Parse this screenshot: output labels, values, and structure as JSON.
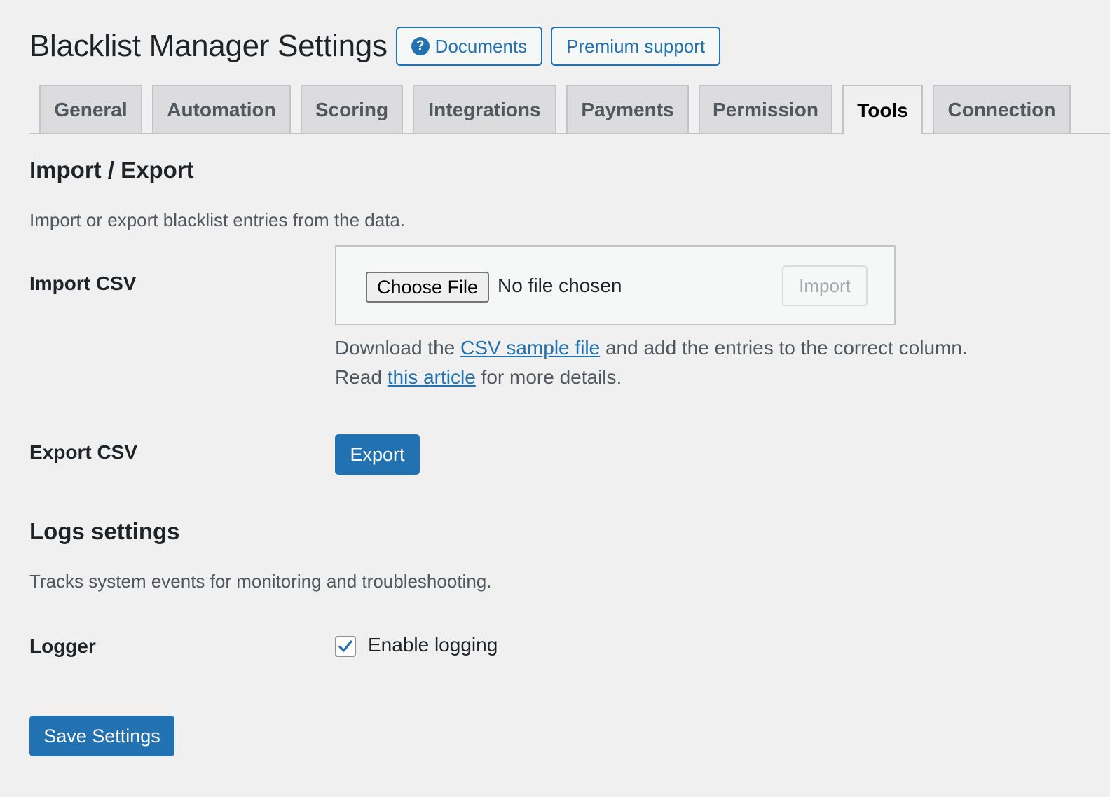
{
  "header": {
    "title": "Blacklist Manager Settings",
    "documents_label": "Documents",
    "premium_label": "Premium support",
    "help_icon": "?"
  },
  "tabs": [
    {
      "label": "General"
    },
    {
      "label": "Automation"
    },
    {
      "label": "Scoring"
    },
    {
      "label": "Integrations"
    },
    {
      "label": "Payments"
    },
    {
      "label": "Permission"
    },
    {
      "label": "Tools",
      "active": true
    },
    {
      "label": "Connection"
    }
  ],
  "import_export": {
    "heading": "Import / Export",
    "description": "Import or export blacklist entries from the data.",
    "import_label": "Import CSV",
    "choose_file": "Choose File",
    "no_file": "No file chosen",
    "import_button": "Import",
    "help1_pre": "Download the ",
    "help1_link": "CSV sample file",
    "help1_post": " and add the entries to the correct column.",
    "help2_pre": "Read ",
    "help2_link": "this article",
    "help2_post": " for more details.",
    "export_label": "Export CSV",
    "export_button": "Export"
  },
  "logs": {
    "heading": "Logs settings",
    "description": "Tracks system events for monitoring and troubleshooting.",
    "logger_label": "Logger",
    "enable_label": "Enable logging",
    "enabled": true
  },
  "save_button": "Save Settings",
  "colors": {
    "accent": "#2271b1",
    "background": "#f0f0f1"
  }
}
